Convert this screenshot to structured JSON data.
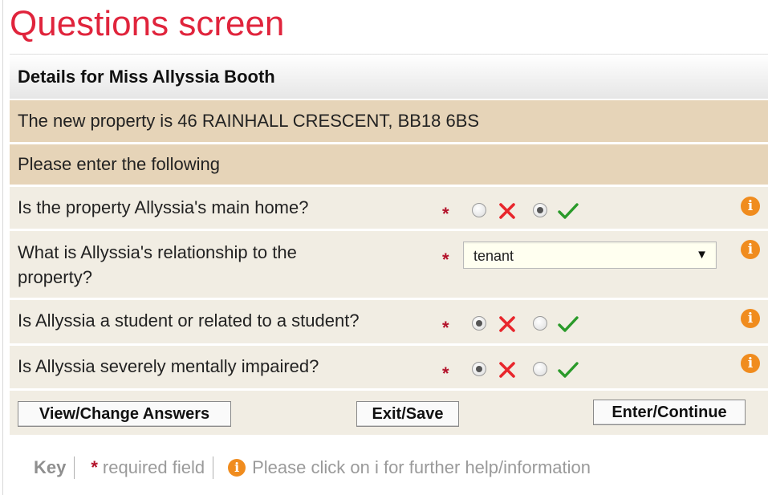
{
  "page": {
    "title": "Questions screen"
  },
  "panel": {
    "header": "Details for Miss Allyssia Booth",
    "property_line": "The new property is 46 RAINHALL CRESCENT, BB18 6BS",
    "instruction": "Please enter the following"
  },
  "questions": [
    {
      "text": "Is the property Allyssia's main home?",
      "type": "yes-no",
      "selected": "yes"
    },
    {
      "text_line1": "What is Allyssia's relationship to the",
      "text_line2": "property?",
      "type": "select",
      "selected_value": "tenant"
    },
    {
      "text": "Is Allyssia a student or related to a student?",
      "type": "yes-no",
      "selected": "no"
    },
    {
      "text": "Is Allyssia severely mentally impaired?",
      "type": "yes-no",
      "selected": "no"
    }
  ],
  "required_marker": "*",
  "info_marker": "i",
  "icons": {
    "no": "cross-icon",
    "yes": "tick-icon",
    "info": "info-icon"
  },
  "buttons": {
    "view_change": "View/Change Answers",
    "exit_save": "Exit/Save",
    "enter_continue": "Enter/Continue"
  },
  "key": {
    "label": "Key",
    "required_text": "required field",
    "info_text": "Please click on i for further help/information"
  },
  "colors": {
    "title": "#e0243c",
    "required": "#b3122a",
    "cross": "#e8262c",
    "tick": "#2a9a2a",
    "info": "#f08c1e",
    "tan_row": "#e6d4b8",
    "question_row": "#f1ede3"
  }
}
